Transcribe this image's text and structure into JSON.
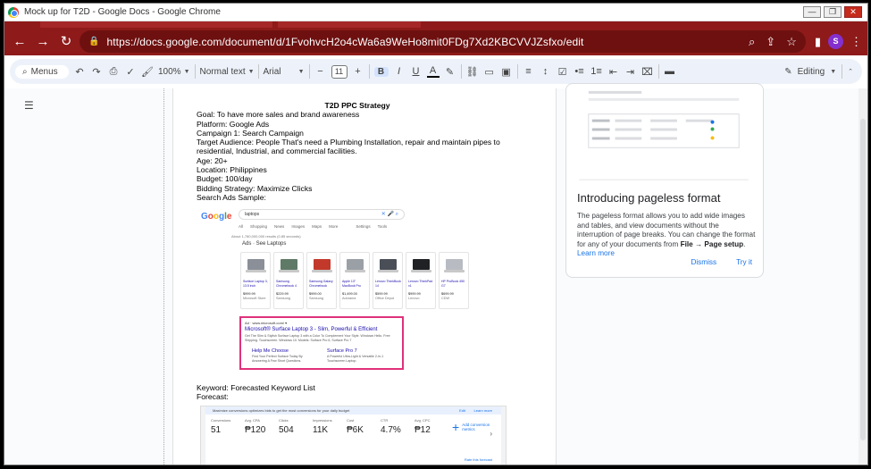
{
  "window": {
    "title": "Mock up for T2D - Google Docs - Google Chrome",
    "minimize": "—",
    "restore": "❐",
    "close": "✕"
  },
  "address": {
    "url": "https://docs.google.com/document/d/1FvohvcH2o4cWa6a9WeHo8mit0FDg7Xd2KBCVVJZsfxo/edit",
    "avatar_letter": "S"
  },
  "toolbar": {
    "menus_label": "Menus",
    "zoom": "100%",
    "style": "Normal text",
    "font": "Arial",
    "font_size": "11",
    "bold": "B",
    "italic": "I",
    "underline": "U",
    "text_color": "A",
    "mode": "Editing"
  },
  "doc": {
    "title": "T2D PPC Strategy",
    "lines": [
      "Goal: To have more sales and brand awareness",
      "Platform: Google Ads",
      "Campaign 1: Search Campaign",
      "Target Audience: People That's need a Plumbing Installation, repair and maintain pipes to residential, Industrial, and commercial facilities.",
      "Age: 20+",
      "Location: Philippines",
      "Budget: 100/day",
      "Bidding Strategy: Maximize Clicks",
      "Search Ads Sample:"
    ],
    "keyword_label": "Keyword:",
    "keyword_link": "Forecasted Keyword List",
    "forecast_label": "Forecast:"
  },
  "search_ad": {
    "logo": [
      "G",
      "o",
      "o",
      "g",
      "l",
      "e"
    ],
    "query": "laptops",
    "tabs": [
      "All",
      "Shopping",
      "News",
      "Images",
      "Maps",
      "More",
      "Settings",
      "Tools"
    ],
    "stats": "About 1,780,000,000 results (0.85 seconds)",
    "ads_label": "Ads · See Laptops",
    "products": [
      {
        "name": "Surface Laptop 3, 13.5 inch",
        "price": "$999.99",
        "seller": "Microsoft Store",
        "color": "#8a8f98"
      },
      {
        "name": "Samsung Chromebook 4",
        "price": "$229.99",
        "seller": "Samsung",
        "color": "#5f7a66"
      },
      {
        "name": "Samsung Galaxy Chromebook",
        "price": "$999.00",
        "seller": "Samsung",
        "color": "#c2392b"
      },
      {
        "name": "Apple 13\" MacBook Pro",
        "price": "$1,499.00",
        "seller": "Adorama",
        "color": "#9aa0a6"
      },
      {
        "name": "Lenovo ThinkBook 14",
        "price": "$599.99",
        "seller": "Office Depot",
        "color": "#4a4f57"
      },
      {
        "name": "Lenovo ThinkPad x1",
        "price": "$999.99",
        "seller": "Lenovo",
        "color": "#1f2125"
      },
      {
        "name": "HP ProBook 450 G7",
        "price": "$699.99",
        "seller": "CDW",
        "color": "#b8bcc2"
      }
    ],
    "ad_url": "Ad · www.microsoft.com/ ▾",
    "ad_title": "Microsoft® Surface Laptop 3 - Slim, Powerful & Efficient",
    "ad_desc": "Get The Slim & Stylish Surface Laptop 3 with a Color To Complement Your Style. Windows Hello. Free Shipping. Touchscreen. Windows 10. Models: Surface Pro 6, Surface Pro 7",
    "sitelinks": [
      {
        "title": "Help Me Choose",
        "desc": "Find Your Perfect Surface Today By Answering A Few Short Questions."
      },
      {
        "title": "Surface Pro 7",
        "desc": "A Powerful Ultra-Light & Versatile 2-in-1 Touchscreen Laptop."
      }
    ]
  },
  "forecast": {
    "banner": "Maximize conversions optimizes bids to get the most conversions for your daily budget",
    "edit": "Edit",
    "learn_more": "Learn more",
    "metrics": [
      {
        "label": "Conversions",
        "value": "51"
      },
      {
        "label": "Avg. CPA",
        "value": "₱120"
      },
      {
        "label": "Clicks",
        "value": "504"
      },
      {
        "label": "Impressions",
        "value": "11K"
      },
      {
        "label": "Cost",
        "value": "₱6K"
      },
      {
        "label": "CTR",
        "value": "4.7%"
      },
      {
        "label": "Avg. CPC",
        "value": "₱12"
      }
    ],
    "add_metrics": "Add conversion metrics",
    "rate": "Rate this forecast"
  },
  "promo": {
    "title": "Introducing pageless format",
    "text_a": "The pageless format allows you to add wide images and tables, and view documents without the interruption of page breaks. You can change the format for any of your documents from ",
    "text_menu": "File → Page setup",
    "text_b": ". ",
    "learn_more": "Learn more",
    "dismiss": "Dismiss",
    "try_it": "Try it"
  }
}
